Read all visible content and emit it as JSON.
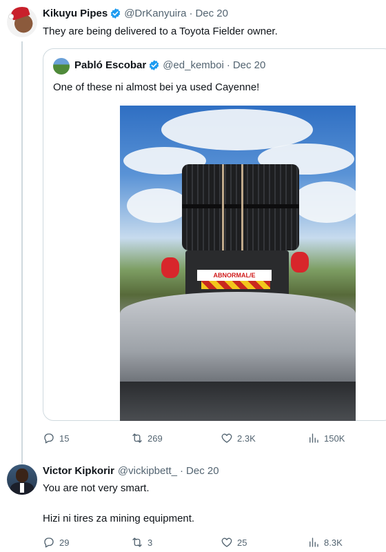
{
  "tweet1": {
    "name": "Kikuyu Pipes",
    "handle": "@DrKanyuira",
    "separator": "·",
    "date": "Dec 20",
    "text": "They are being delivered to a Toyota Fielder owner.",
    "quoted": {
      "name": "Pabló Escobar",
      "handle": "@ed_kemboi",
      "separator": "·",
      "date": "Dec 20",
      "text": "One of these ni almost bei ya used Cayenne!",
      "photo_sign_text": "ABNORMAL/E"
    },
    "stats": {
      "replies": "15",
      "retweets": "269",
      "likes": "2.3K",
      "views": "150K"
    }
  },
  "tweet2": {
    "name": "Victor Kipkorir",
    "handle": "@vickipbett_",
    "separator": "·",
    "date": "Dec 20",
    "text_line1": "You are not very smart.",
    "text_line2": "Hizi ni tires za mining equipment.",
    "stats": {
      "replies": "29",
      "retweets": "3",
      "likes": "25",
      "views": "8.3K"
    }
  },
  "icons": [
    "verified-badge-icon",
    "reply-icon",
    "retweet-icon",
    "like-icon",
    "views-icon"
  ],
  "colors": {
    "text": "#0f1419",
    "secondary": "#536471",
    "verified": "#1d9bf0",
    "border": "#cfd9de"
  }
}
